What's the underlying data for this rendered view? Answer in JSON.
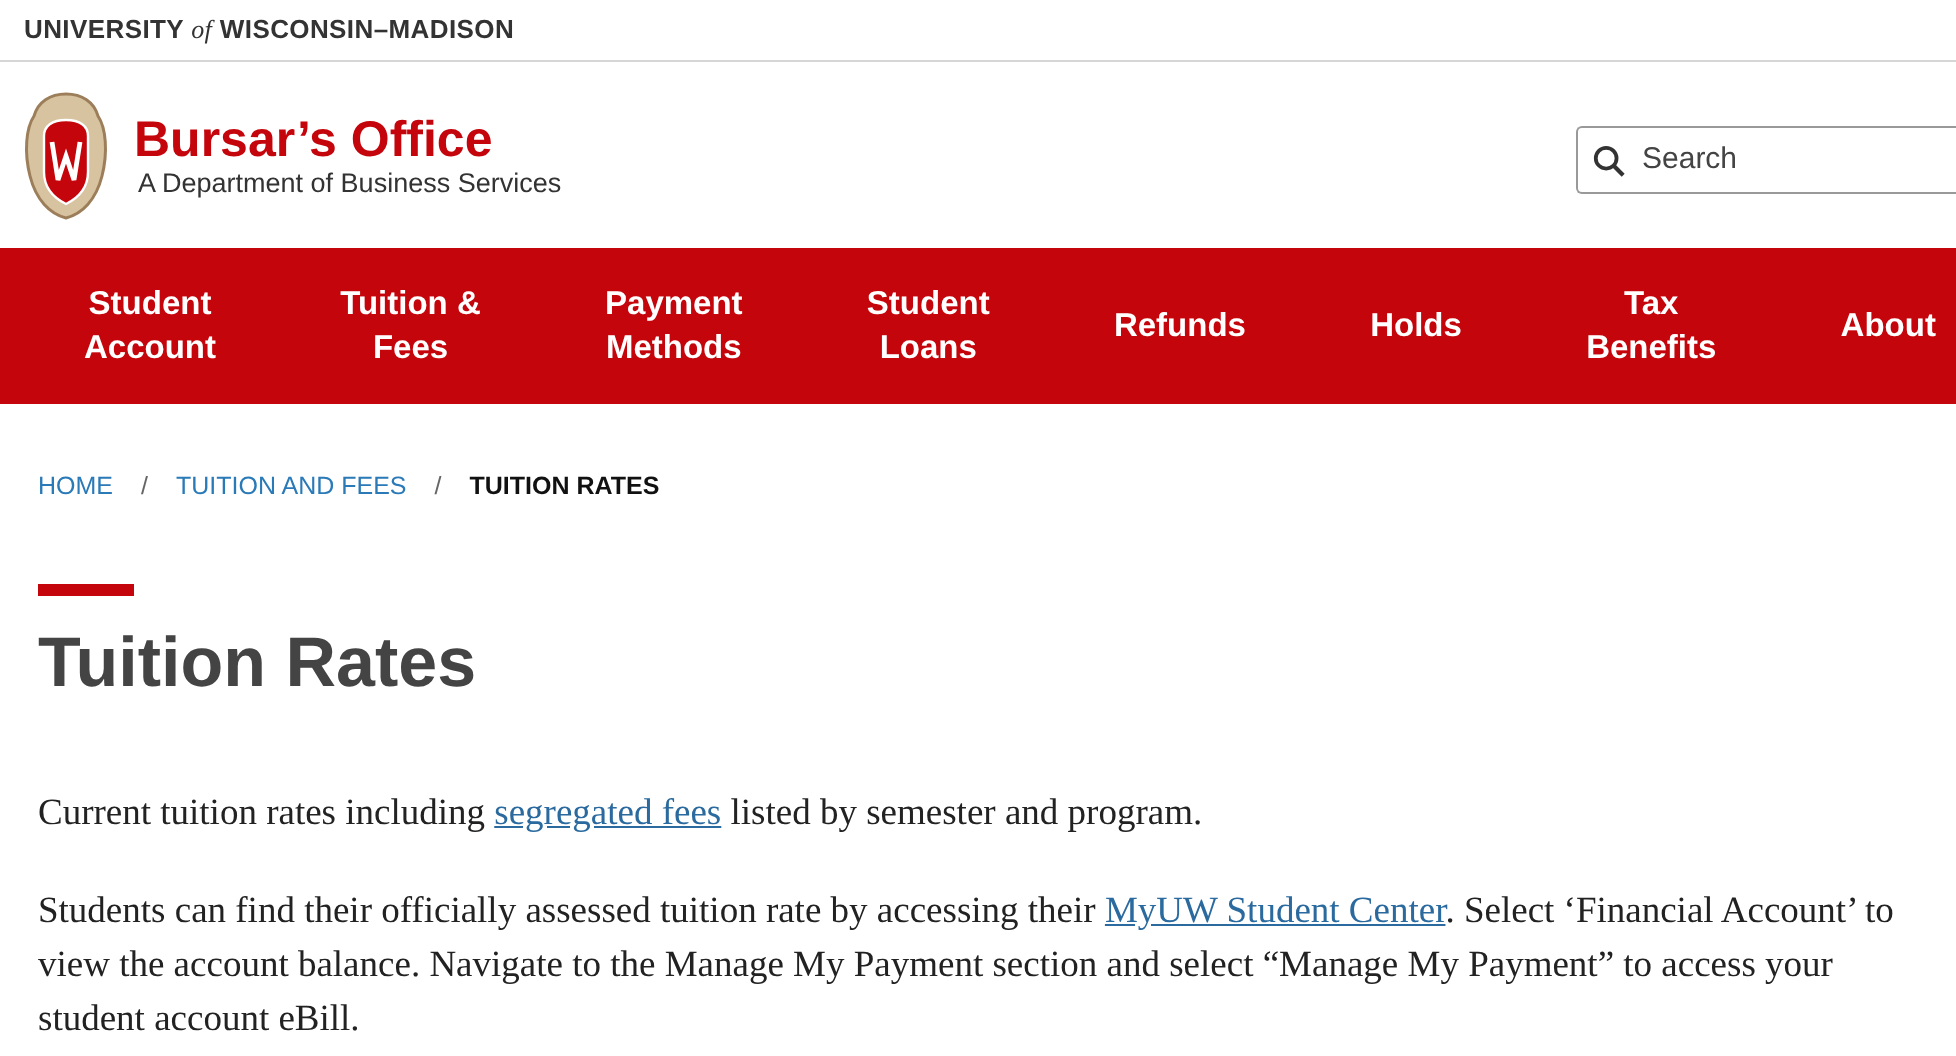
{
  "top_bar": {
    "university": "UNIVERSITY of WISCONSIN–MADISON"
  },
  "header": {
    "title": "Bursar’s Office",
    "subtitle": "A Department of Business Services"
  },
  "search": {
    "placeholder": "Search"
  },
  "nav": [
    {
      "label": "Student\nAccount"
    },
    {
      "label": "Tuition &\nFees"
    },
    {
      "label": "Payment\nMethods"
    },
    {
      "label": "Student\nLoans"
    },
    {
      "label": "Refunds"
    },
    {
      "label": "Holds"
    },
    {
      "label": "Tax\nBenefits"
    },
    {
      "label": "About"
    }
  ],
  "breadcrumb": [
    {
      "label": "HOME",
      "current": false
    },
    {
      "label": "TUITION AND FEES",
      "current": false
    },
    {
      "label": "TUITION RATES",
      "current": true
    }
  ],
  "breadcrumb_separator": "/",
  "page_title": "Tuition Rates",
  "paragraphs": [
    [
      {
        "kind": "text",
        "text": "Current tuition rates including "
      },
      {
        "kind": "link",
        "text": "segregated fees"
      },
      {
        "kind": "text",
        "text": " listed by semester and program."
      }
    ],
    [
      {
        "kind": "text",
        "text": "Students can find their officially assessed tuition rate by accessing their "
      },
      {
        "kind": "link",
        "text": "MyUW Student Center"
      },
      {
        "kind": "text",
        "text": ". Select ‘Financial Account’ to view the account balance.  Navigate to the Manage My Payment section and select “Manage My Payment” to access your student account eBill."
      }
    ]
  ]
}
